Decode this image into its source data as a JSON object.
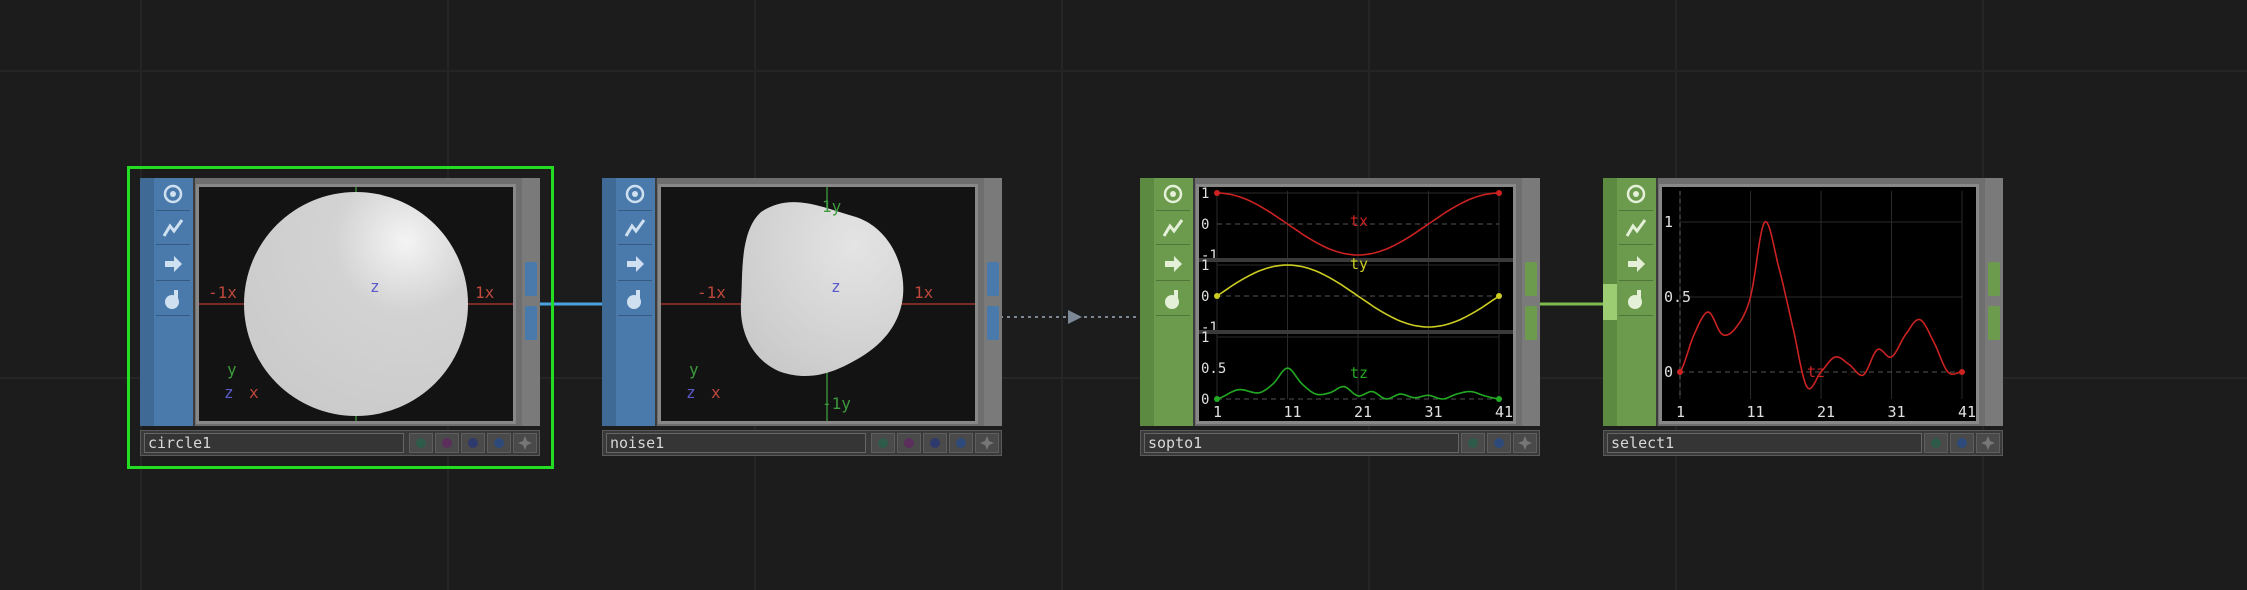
{
  "nodes": {
    "circle1": {
      "name": "circle1",
      "labels": {
        "neg_x": "-1x",
        "pos_x": "1x",
        "z": "z",
        "axis_y": "y",
        "axis_z": "z",
        "axis_x": "x"
      }
    },
    "noise1": {
      "name": "noise1",
      "labels": {
        "neg_x": "-1x",
        "pos_x": "1x",
        "z": "z",
        "pos_y": "1y",
        "neg_y": "-1y",
        "axis_y": "y",
        "axis_z": "z",
        "axis_x": "x"
      }
    },
    "sopto1": {
      "name": "sopto1",
      "x_ticks": [
        "1",
        "11",
        "21",
        "31",
        "41"
      ],
      "channels": [
        {
          "name": "tx",
          "color": "#cc2222",
          "y_labels": [
            "1",
            "0",
            "-1"
          ]
        },
        {
          "name": "ty",
          "color": "#cccc22",
          "y_labels": [
            "1",
            "0",
            "-1"
          ]
        },
        {
          "name": "tz",
          "color": "#22aa22",
          "y_labels": [
            "1",
            "0.5",
            "0"
          ]
        }
      ]
    },
    "select1": {
      "name": "select1",
      "x_ticks": [
        "1",
        "11",
        "21",
        "31",
        "41"
      ],
      "y_labels": [
        "1",
        "0.5",
        "0"
      ],
      "channel": {
        "name": "tz",
        "color": "#cc2222"
      }
    }
  },
  "colors": {
    "sop_family": "#4a7aab",
    "chop_family": "#6d9b4e",
    "selected": "#22dd22",
    "sop_wire": "#4aa3e0",
    "chop_wire": "#7dbb4c",
    "dotted_wire": "#7c8896"
  },
  "icons": [
    "viewer-toggle-icon",
    "cook-icon",
    "export-icon",
    "lock-icon",
    "bypass-flag-icon",
    "display-flag-icon",
    "render-flag-icon",
    "template-flag-icon",
    "expose-icon"
  ],
  "chart_data": [
    {
      "type": "line",
      "title": "",
      "x": [
        1,
        11,
        21,
        31,
        41
      ],
      "series": [
        {
          "name": "tx",
          "values": [
            1.0,
            0.0,
            -1.0,
            0.0,
            1.0
          ]
        },
        {
          "name": "ty",
          "values": [
            0.0,
            1.0,
            0.0,
            -1.0,
            0.0
          ]
        },
        {
          "name": "tz",
          "values": [
            0.0,
            0.5,
            0.1,
            0.0,
            0.0
          ]
        }
      ],
      "xlim": [
        1,
        41
      ]
    },
    {
      "type": "line",
      "title": "",
      "x": [
        1,
        3,
        5,
        7,
        9,
        11,
        13,
        15,
        17,
        19,
        21,
        23,
        25,
        27,
        29,
        31,
        33,
        35,
        37,
        39,
        41
      ],
      "series": [
        {
          "name": "tz",
          "values": [
            0.0,
            0.25,
            0.4,
            0.25,
            0.3,
            0.5,
            1.0,
            0.7,
            0.3,
            -0.1,
            0.0,
            0.1,
            0.05,
            -0.02,
            0.15,
            0.1,
            0.25,
            0.35,
            0.2,
            0.0,
            0.0
          ]
        }
      ],
      "ylim": [
        -0.1,
        1.1
      ],
      "xlim": [
        1,
        41
      ]
    }
  ]
}
